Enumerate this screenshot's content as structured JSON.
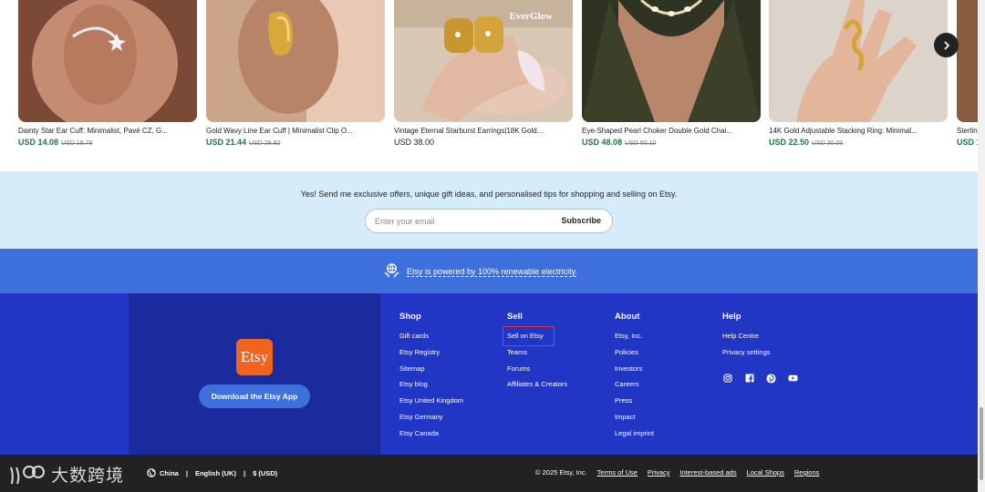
{
  "products": [
    {
      "title": "Dainty Star Ear Cuff: Minimalist, Pavé CZ, G...",
      "price": "USD 14.08",
      "old_price": "USD 18.78",
      "on_sale": true
    },
    {
      "title": "Gold Wavy Line Ear Cuff | Minimalist Clip O...",
      "price": "USD 21.44",
      "old_price": "USD 29.82",
      "on_sale": true
    },
    {
      "title": "Vintage Eternal Starburst Earrings|18K Gold...",
      "price": "USD 38.00",
      "old_price": "",
      "on_sale": false,
      "overlay": "EverGlow"
    },
    {
      "title": "Eye-Shaped Pearl Choker Double Gold Chai...",
      "price": "USD 48.08",
      "old_price": "USD 60.10",
      "on_sale": true
    },
    {
      "title": "14K Gold Adjustable Stacking Ring: Minimal...",
      "price": "USD 22.50",
      "old_price": "USD 30.00",
      "on_sale": true
    },
    {
      "title": "Sterlin",
      "price": "USD 1",
      "old_price": "",
      "on_sale": true
    }
  ],
  "newsletter": {
    "text": "Yes! Send me exclusive offers, unique gift ideas, and personalised tips for shopping and selling on Etsy.",
    "placeholder": "Enter your email",
    "button": "Subscribe"
  },
  "renewable": {
    "text": "Etsy is powered by 100% renewable electricity."
  },
  "footer": {
    "logo": "Etsy",
    "app_button": "Download the Etsy App",
    "shop": {
      "heading": "Shop",
      "links": [
        "Gift cards",
        "Etsy Registry",
        "Sitemap",
        "Etsy blog",
        "Etsy United Kingdom",
        "Etsy Germany",
        "Etsy Canada"
      ]
    },
    "sell": {
      "heading": "Sell",
      "links": [
        "Sell on Etsy",
        "Teams",
        "Forums",
        "Affiliates & Creators"
      ]
    },
    "about": {
      "heading": "About",
      "links": [
        "Etsy, Inc.",
        "Policies",
        "Investors",
        "Careers",
        "Press",
        "Impact",
        "Legal imprint"
      ]
    },
    "help": {
      "heading": "Help",
      "links": [
        "Help Centre",
        "Privacy settings"
      ]
    },
    "social_icons": [
      "instagram-icon",
      "facebook-icon",
      "pinterest-icon",
      "youtube-icon"
    ]
  },
  "bottom": {
    "region": "China",
    "language": "English (UK)",
    "currency": "$ (USD)",
    "copyright": "© 2025 Etsy, Inc.",
    "links": [
      "Terms of Use",
      "Privacy",
      "Interest-based ads",
      "Local Shops",
      "Regions"
    ]
  },
  "watermark": {
    "text": "大数跨境"
  },
  "colors": {
    "sale_green": "#1d7a3a",
    "footer_blue": "#2236c5",
    "renew_blue": "#3d6fdd",
    "newsletter_bg": "#d6ecfa",
    "etsy_orange": "#f1641e",
    "highlight_red": "#e5323f"
  }
}
